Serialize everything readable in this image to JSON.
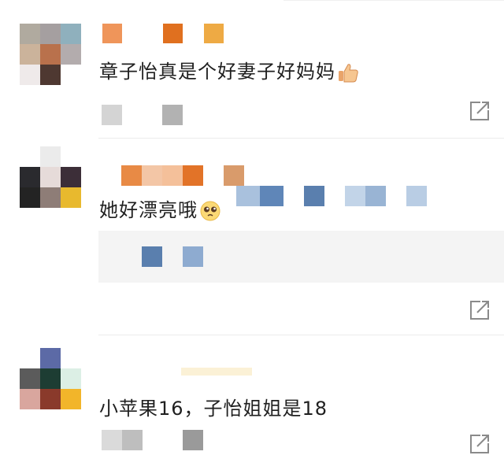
{
  "comments": [
    {
      "text": "章子怡真是个好妻子好妈妈",
      "emoji": "thumbs-up",
      "action": "share"
    },
    {
      "text": "她好漂亮哦",
      "emoji": "pleading-face",
      "action": "share"
    },
    {
      "text": "小苹果16，子怡姐姐是18",
      "action": "share"
    }
  ],
  "colors": {
    "orange": "#e07a2e",
    "orange_light": "#f0a46a",
    "blue": "#5a7fae",
    "blue_light": "#a9c1dd",
    "gray": "#a8a8a8",
    "divider": "#ececec",
    "reply_bg": "#f4f4f4"
  }
}
